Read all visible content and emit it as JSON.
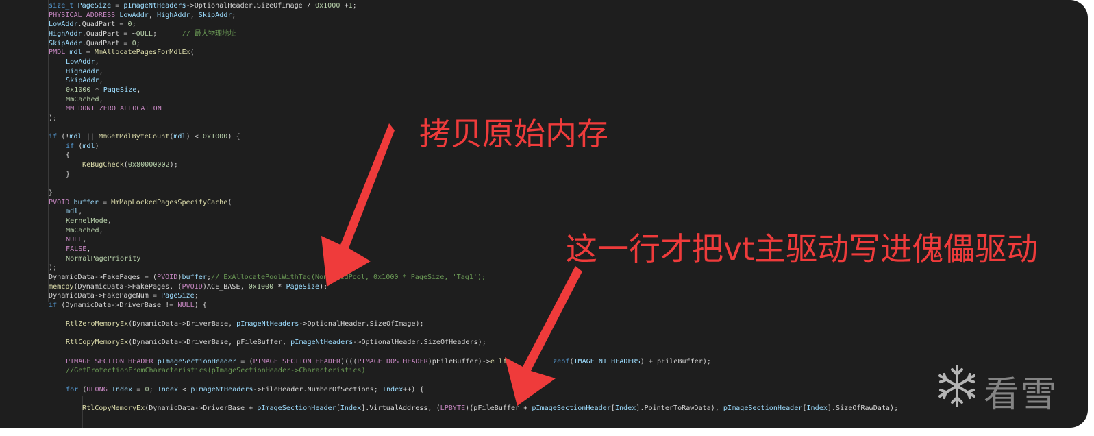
{
  "colors": {
    "background": "#1e1e1e",
    "annotation": "#ef3b3b",
    "type": "#4ec9b0",
    "variable": "#9cdcfe",
    "function": "#dcdcaa",
    "keyword": "#569cd6",
    "number": "#b5cea8",
    "comment": "#6a9955",
    "text": "#d4d4d4",
    "macro": "#c586c0"
  },
  "code_lines": [
    {
      "indent": 1,
      "tokens": [
        [
          "size_t ",
          "k"
        ],
        [
          "PageSize",
          "v"
        ],
        [
          " = ",
          "t"
        ],
        [
          "pImageNtHeaders",
          "v"
        ],
        [
          "->OptionalHeader.SizeOfImage / ",
          "t"
        ],
        [
          "0x1000",
          "n"
        ],
        [
          " +",
          "t"
        ],
        [
          "1",
          "n"
        ],
        [
          ";",
          "t"
        ]
      ]
    },
    {
      "indent": 1,
      "tokens": [
        [
          "PHYSICAL_ADDRESS ",
          "m"
        ],
        [
          "LowAddr",
          "v"
        ],
        [
          ", ",
          "t"
        ],
        [
          "HighAddr",
          "v"
        ],
        [
          ", ",
          "t"
        ],
        [
          "SkipAddr",
          "v"
        ],
        [
          ";",
          "t"
        ]
      ]
    },
    {
      "indent": 1,
      "tokens": [
        [
          "LowAddr",
          "v"
        ],
        [
          ".QuadPart = ",
          "t"
        ],
        [
          "0",
          "n"
        ],
        [
          ";",
          "t"
        ]
      ]
    },
    {
      "indent": 1,
      "tokens": [
        [
          "HighAddr",
          "v"
        ],
        [
          ".QuadPart = ~",
          "t"
        ],
        [
          "0ULL",
          "n"
        ],
        [
          ";      ",
          "t"
        ],
        [
          "// 最大物理地址",
          "c"
        ]
      ]
    },
    {
      "indent": 1,
      "tokens": [
        [
          "SkipAddr",
          "v"
        ],
        [
          ".QuadPart = ",
          "t"
        ],
        [
          "0",
          "n"
        ],
        [
          ";",
          "t"
        ]
      ]
    },
    {
      "indent": 1,
      "tokens": [
        [
          "PMDL ",
          "m"
        ],
        [
          "mdl",
          "v"
        ],
        [
          " = ",
          "t"
        ],
        [
          "MmAllocatePagesForMdlEx",
          "f"
        ],
        [
          "(",
          "t"
        ]
      ]
    },
    {
      "indent": 2,
      "tokens": [
        [
          "LowAddr",
          "v"
        ],
        [
          ",",
          "t"
        ]
      ]
    },
    {
      "indent": 2,
      "tokens": [
        [
          "HighAddr",
          "v"
        ],
        [
          ",",
          "t"
        ]
      ]
    },
    {
      "indent": 2,
      "tokens": [
        [
          "SkipAddr",
          "v"
        ],
        [
          ",",
          "t"
        ]
      ]
    },
    {
      "indent": 2,
      "tokens": [
        [
          "0x1000",
          "n"
        ],
        [
          " * ",
          "t"
        ],
        [
          "PageSize",
          "v"
        ],
        [
          ",",
          "t"
        ]
      ]
    },
    {
      "indent": 2,
      "tokens": [
        [
          "MmCached",
          "n"
        ],
        [
          ",",
          "t"
        ]
      ]
    },
    {
      "indent": 2,
      "tokens": [
        [
          "MM_DONT_ZERO_ALLOCATION",
          "m"
        ]
      ]
    },
    {
      "indent": 1,
      "tokens": [
        [
          ");",
          "t"
        ]
      ]
    },
    {
      "indent": 1,
      "tokens": [
        [
          "",
          "t"
        ]
      ]
    },
    {
      "indent": 1,
      "tokens": [
        [
          "if",
          "k"
        ],
        [
          " (!",
          "t"
        ],
        [
          "mdl",
          "v"
        ],
        [
          " || ",
          "t"
        ],
        [
          "MmGetMdlByteCount",
          "f"
        ],
        [
          "(",
          "t"
        ],
        [
          "mdl",
          "v"
        ],
        [
          ") < ",
          "t"
        ],
        [
          "0x1000",
          "n"
        ],
        [
          ") {",
          "t"
        ]
      ]
    },
    {
      "indent": 2,
      "tokens": [
        [
          "if",
          "k"
        ],
        [
          " (",
          "t"
        ],
        [
          "mdl",
          "v"
        ],
        [
          ")",
          "t"
        ]
      ]
    },
    {
      "indent": 2,
      "tokens": [
        [
          "{",
          "t"
        ]
      ]
    },
    {
      "indent": 3,
      "tokens": [
        [
          "KeBugCheck",
          "f"
        ],
        [
          "(",
          "t"
        ],
        [
          "0x80000002",
          "n"
        ],
        [
          ");",
          "t"
        ]
      ]
    },
    {
      "indent": 2,
      "tokens": [
        [
          "}",
          "t"
        ]
      ]
    },
    {
      "indent": 1,
      "tokens": [
        [
          "",
          "t"
        ]
      ]
    },
    {
      "indent": 1,
      "tokens": [
        [
          "}",
          "t"
        ]
      ]
    },
    {
      "indent": 1,
      "tokens": [
        [
          "PVOID ",
          "m"
        ],
        [
          "buffer",
          "v"
        ],
        [
          " = ",
          "t"
        ],
        [
          "MmMapLockedPagesSpecifyCache",
          "f"
        ],
        [
          "(",
          "t"
        ]
      ]
    },
    {
      "indent": 2,
      "tokens": [
        [
          "mdl",
          "v"
        ],
        [
          ",",
          "t"
        ]
      ]
    },
    {
      "indent": 2,
      "tokens": [
        [
          "KernelMode",
          "n"
        ],
        [
          ",",
          "t"
        ]
      ]
    },
    {
      "indent": 2,
      "tokens": [
        [
          "MmCached",
          "n"
        ],
        [
          ",",
          "t"
        ]
      ]
    },
    {
      "indent": 2,
      "tokens": [
        [
          "NULL",
          "m"
        ],
        [
          ",",
          "t"
        ]
      ]
    },
    {
      "indent": 2,
      "tokens": [
        [
          "FALSE",
          "m"
        ],
        [
          ",",
          "t"
        ]
      ]
    },
    {
      "indent": 2,
      "tokens": [
        [
          "NormalPagePriority",
          "n"
        ]
      ]
    },
    {
      "indent": 1,
      "tokens": [
        [
          ");",
          "t"
        ]
      ]
    },
    {
      "indent": 1,
      "tokens": [
        [
          "DynamicData",
          "t"
        ],
        [
          "->FakePages = (",
          "t"
        ],
        [
          "PVOID",
          "m"
        ],
        [
          ")",
          "t"
        ],
        [
          "buffer",
          "v"
        ],
        [
          ";",
          "t"
        ],
        [
          "// ExAllocatePoolWithTag(NonPagedPool, 0x1000 * PageSize, 'Tag1');",
          "c"
        ]
      ]
    },
    {
      "indent": 1,
      "tokens": [
        [
          "memcpy",
          "f"
        ],
        [
          "(",
          "t"
        ],
        [
          "DynamicData",
          "t"
        ],
        [
          "->FakePages, (",
          "t"
        ],
        [
          "PVOID",
          "m"
        ],
        [
          ")",
          "t"
        ],
        [
          "ACE_BASE",
          "t"
        ],
        [
          ", ",
          "t"
        ],
        [
          "0x1000",
          "n"
        ],
        [
          " * ",
          "t"
        ],
        [
          "PageSize",
          "v"
        ],
        [
          ");",
          "t"
        ]
      ]
    },
    {
      "indent": 1,
      "tokens": [
        [
          "DynamicData",
          "t"
        ],
        [
          "->FakePageNum = ",
          "t"
        ],
        [
          "PageSize",
          "v"
        ],
        [
          ";",
          "t"
        ]
      ]
    },
    {
      "indent": 1,
      "tokens": [
        [
          "if",
          "k"
        ],
        [
          " (",
          "t"
        ],
        [
          "DynamicData",
          "t"
        ],
        [
          "->DriverBase != ",
          "t"
        ],
        [
          "NULL",
          "m"
        ],
        [
          ") {",
          "t"
        ]
      ]
    },
    {
      "indent": 1,
      "tokens": [
        [
          "",
          "t"
        ]
      ]
    },
    {
      "indent": 2,
      "tokens": [
        [
          "RtlZeroMemoryEx",
          "f"
        ],
        [
          "(",
          "t"
        ],
        [
          "DynamicData",
          "t"
        ],
        [
          "->DriverBase, ",
          "t"
        ],
        [
          "pImageNtHeaders",
          "v"
        ],
        [
          "->OptionalHeader.SizeOfImage);",
          "t"
        ]
      ]
    },
    {
      "indent": 1,
      "tokens": [
        [
          "",
          "t"
        ]
      ]
    },
    {
      "indent": 2,
      "tokens": [
        [
          "RtlCopyMemoryEx",
          "f"
        ],
        [
          "(",
          "t"
        ],
        [
          "DynamicData",
          "t"
        ],
        [
          "->DriverBase, pFileBuffer, ",
          "t"
        ],
        [
          "pImageNtHeaders",
          "v"
        ],
        [
          "->OptionalHeader.SizeOfHeaders);",
          "t"
        ]
      ]
    },
    {
      "indent": 1,
      "tokens": [
        [
          "",
          "t"
        ]
      ]
    },
    {
      "indent": 2,
      "tokens": [
        [
          "PIMAGE_SECTION_HEADER ",
          "m"
        ],
        [
          "pImageSectionHeader",
          "v"
        ],
        [
          " = (",
          "t"
        ],
        [
          "PIMAGE_SECTION_HEADER",
          "m"
        ],
        [
          ")(((",
          "t"
        ],
        [
          "PIMAGE_DOS_HEADER",
          "m"
        ],
        [
          ")pFileBuffer)->",
          "t"
        ],
        [
          "e_lfa",
          "f"
        ],
        [
          "          ",
          "t"
        ],
        [
          "zeof",
          "k"
        ],
        [
          "(",
          "t"
        ],
        [
          "IMAGE_NT_HEADERS",
          "v"
        ],
        [
          ") + pFileBuffer);",
          "t"
        ]
      ]
    },
    {
      "indent": 2,
      "tokens": [
        [
          "//GetProtectionFromCharacteristics(pImageSectionHeader->Characteristics)",
          "c"
        ]
      ]
    },
    {
      "indent": 1,
      "tokens": [
        [
          "",
          "t"
        ]
      ]
    },
    {
      "indent": 2,
      "tokens": [
        [
          "for",
          "k"
        ],
        [
          " (",
          "t"
        ],
        [
          "ULONG ",
          "m"
        ],
        [
          "Index",
          "v"
        ],
        [
          " = ",
          "t"
        ],
        [
          "0",
          "n"
        ],
        [
          "; ",
          "t"
        ],
        [
          "Index",
          "v"
        ],
        [
          " < ",
          "t"
        ],
        [
          "pImageNtHeaders",
          "v"
        ],
        [
          "->FileHeader.NumberOfSections; ",
          "t"
        ],
        [
          "Index",
          "v"
        ],
        [
          "++) {",
          "t"
        ]
      ]
    },
    {
      "indent": 1,
      "tokens": [
        [
          "",
          "t"
        ]
      ]
    },
    {
      "indent": 3,
      "tokens": [
        [
          "RtlCopyMemoryEx",
          "f"
        ],
        [
          "(",
          "t"
        ],
        [
          "DynamicData",
          "t"
        ],
        [
          "->DriverBase + ",
          "t"
        ],
        [
          "pImageSectionHeader",
          "v"
        ],
        [
          "[",
          "t"
        ],
        [
          "Index",
          "v"
        ],
        [
          "].VirtualAddress, (",
          "t"
        ],
        [
          "LPBYTE",
          "m"
        ],
        [
          ")(pFileBuffer + ",
          "t"
        ],
        [
          "pImageSectionHeader",
          "v"
        ],
        [
          "[",
          "t"
        ],
        [
          "Index",
          "v"
        ],
        [
          "].PointerToRawData), ",
          "t"
        ],
        [
          "pImageSectionHeader",
          "v"
        ],
        [
          "[",
          "t"
        ],
        [
          "Index",
          "v"
        ],
        [
          "].SizeOfRawData);",
          "t"
        ]
      ]
    }
  ],
  "annotations": {
    "copy_memory": "拷贝原始内存",
    "write_driver": "这一行才把vt主驱动写进傀儡驱动"
  },
  "watermark": {
    "icon": "snowflake-icon",
    "text": "看雪"
  }
}
